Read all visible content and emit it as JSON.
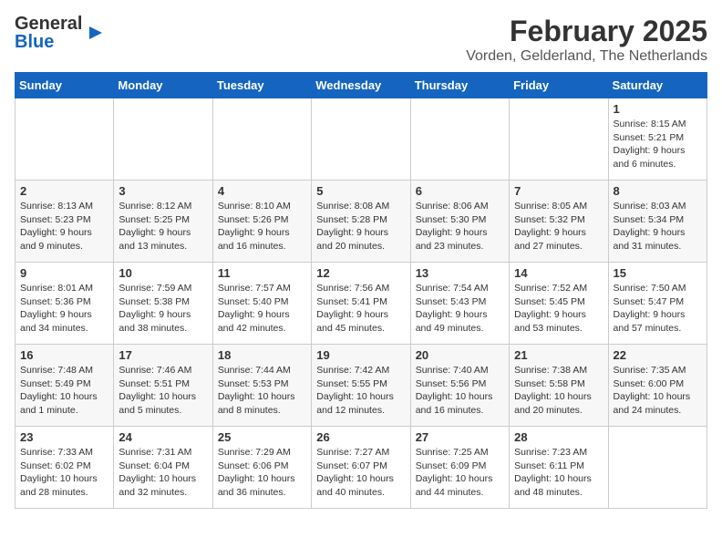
{
  "header": {
    "logo_line1": "General",
    "logo_line2": "Blue",
    "title": "February 2025",
    "subtitle": "Vorden, Gelderland, The Netherlands"
  },
  "days_of_week": [
    "Sunday",
    "Monday",
    "Tuesday",
    "Wednesday",
    "Thursday",
    "Friday",
    "Saturday"
  ],
  "weeks": [
    [
      {
        "day": "",
        "info": ""
      },
      {
        "day": "",
        "info": ""
      },
      {
        "day": "",
        "info": ""
      },
      {
        "day": "",
        "info": ""
      },
      {
        "day": "",
        "info": ""
      },
      {
        "day": "",
        "info": ""
      },
      {
        "day": "1",
        "info": "Sunrise: 8:15 AM\nSunset: 5:21 PM\nDaylight: 9 hours and 6 minutes."
      }
    ],
    [
      {
        "day": "2",
        "info": "Sunrise: 8:13 AM\nSunset: 5:23 PM\nDaylight: 9 hours and 9 minutes."
      },
      {
        "day": "3",
        "info": "Sunrise: 8:12 AM\nSunset: 5:25 PM\nDaylight: 9 hours and 13 minutes."
      },
      {
        "day": "4",
        "info": "Sunrise: 8:10 AM\nSunset: 5:26 PM\nDaylight: 9 hours and 16 minutes."
      },
      {
        "day": "5",
        "info": "Sunrise: 8:08 AM\nSunset: 5:28 PM\nDaylight: 9 hours and 20 minutes."
      },
      {
        "day": "6",
        "info": "Sunrise: 8:06 AM\nSunset: 5:30 PM\nDaylight: 9 hours and 23 minutes."
      },
      {
        "day": "7",
        "info": "Sunrise: 8:05 AM\nSunset: 5:32 PM\nDaylight: 9 hours and 27 minutes."
      },
      {
        "day": "8",
        "info": "Sunrise: 8:03 AM\nSunset: 5:34 PM\nDaylight: 9 hours and 31 minutes."
      }
    ],
    [
      {
        "day": "9",
        "info": "Sunrise: 8:01 AM\nSunset: 5:36 PM\nDaylight: 9 hours and 34 minutes."
      },
      {
        "day": "10",
        "info": "Sunrise: 7:59 AM\nSunset: 5:38 PM\nDaylight: 9 hours and 38 minutes."
      },
      {
        "day": "11",
        "info": "Sunrise: 7:57 AM\nSunset: 5:40 PM\nDaylight: 9 hours and 42 minutes."
      },
      {
        "day": "12",
        "info": "Sunrise: 7:56 AM\nSunset: 5:41 PM\nDaylight: 9 hours and 45 minutes."
      },
      {
        "day": "13",
        "info": "Sunrise: 7:54 AM\nSunset: 5:43 PM\nDaylight: 9 hours and 49 minutes."
      },
      {
        "day": "14",
        "info": "Sunrise: 7:52 AM\nSunset: 5:45 PM\nDaylight: 9 hours and 53 minutes."
      },
      {
        "day": "15",
        "info": "Sunrise: 7:50 AM\nSunset: 5:47 PM\nDaylight: 9 hours and 57 minutes."
      }
    ],
    [
      {
        "day": "16",
        "info": "Sunrise: 7:48 AM\nSunset: 5:49 PM\nDaylight: 10 hours and 1 minute."
      },
      {
        "day": "17",
        "info": "Sunrise: 7:46 AM\nSunset: 5:51 PM\nDaylight: 10 hours and 5 minutes."
      },
      {
        "day": "18",
        "info": "Sunrise: 7:44 AM\nSunset: 5:53 PM\nDaylight: 10 hours and 8 minutes."
      },
      {
        "day": "19",
        "info": "Sunrise: 7:42 AM\nSunset: 5:55 PM\nDaylight: 10 hours and 12 minutes."
      },
      {
        "day": "20",
        "info": "Sunrise: 7:40 AM\nSunset: 5:56 PM\nDaylight: 10 hours and 16 minutes."
      },
      {
        "day": "21",
        "info": "Sunrise: 7:38 AM\nSunset: 5:58 PM\nDaylight: 10 hours and 20 minutes."
      },
      {
        "day": "22",
        "info": "Sunrise: 7:35 AM\nSunset: 6:00 PM\nDaylight: 10 hours and 24 minutes."
      }
    ],
    [
      {
        "day": "23",
        "info": "Sunrise: 7:33 AM\nSunset: 6:02 PM\nDaylight: 10 hours and 28 minutes."
      },
      {
        "day": "24",
        "info": "Sunrise: 7:31 AM\nSunset: 6:04 PM\nDaylight: 10 hours and 32 minutes."
      },
      {
        "day": "25",
        "info": "Sunrise: 7:29 AM\nSunset: 6:06 PM\nDaylight: 10 hours and 36 minutes."
      },
      {
        "day": "26",
        "info": "Sunrise: 7:27 AM\nSunset: 6:07 PM\nDaylight: 10 hours and 40 minutes."
      },
      {
        "day": "27",
        "info": "Sunrise: 7:25 AM\nSunset: 6:09 PM\nDaylight: 10 hours and 44 minutes."
      },
      {
        "day": "28",
        "info": "Sunrise: 7:23 AM\nSunset: 6:11 PM\nDaylight: 10 hours and 48 minutes."
      },
      {
        "day": "",
        "info": ""
      }
    ]
  ]
}
